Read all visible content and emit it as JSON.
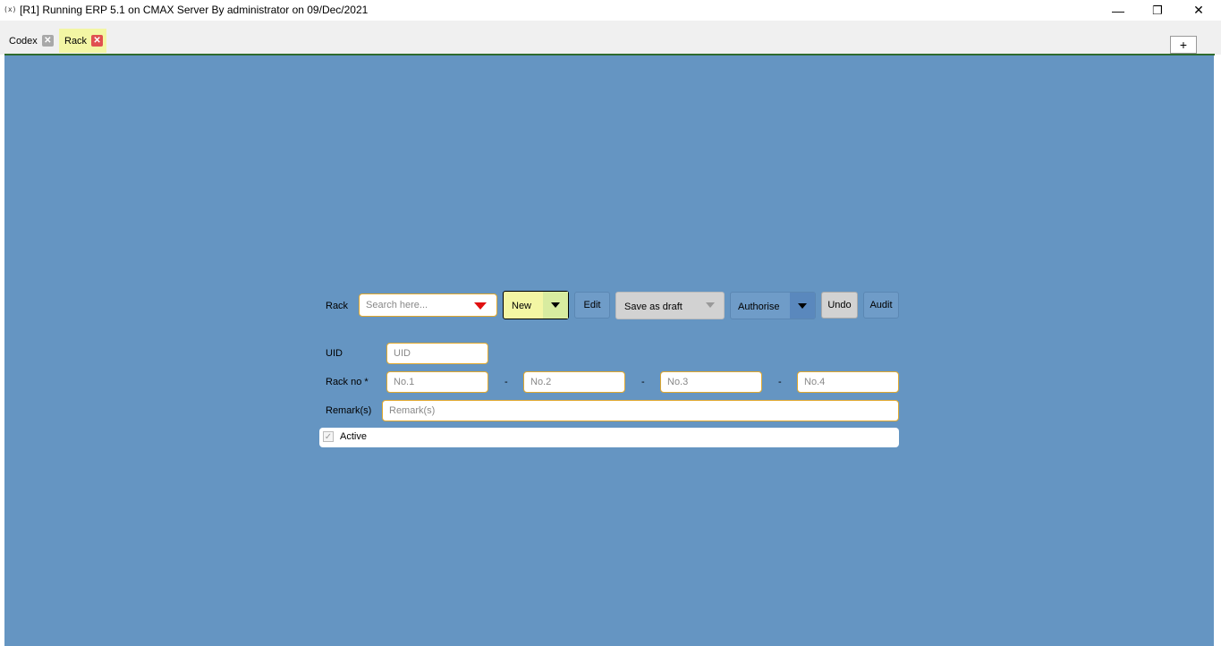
{
  "window": {
    "icon_text": "(x)",
    "title": "[R1] Running ERP 5.1 on CMAX Server By administrator on 09/Dec/2021",
    "minimize": "—",
    "restore": "❐",
    "close": "✕"
  },
  "tabs": [
    {
      "label": "Codex",
      "close": "✕",
      "active": false
    },
    {
      "label": "Rack",
      "close": "✕",
      "active": true
    }
  ],
  "add_tab_label": "+",
  "toolbar": {
    "rack_label": "Rack",
    "search_placeholder": "Search here...",
    "new_label": "New",
    "edit_label": "Edit",
    "save_draft_label": "Save as draft",
    "authorise_label": "Authorise",
    "undo_label": "Undo",
    "audit_label": "Audit"
  },
  "form": {
    "uid_label": "UID",
    "uid_placeholder": "UID",
    "rackno_label": "Rack no  *",
    "no1_placeholder": "No.1",
    "no2_placeholder": "No.2",
    "no3_placeholder": "No.3",
    "no4_placeholder": "No.4",
    "separator": "-",
    "remarks_label": "Remark(s)",
    "remarks_placeholder": "Remark(s)",
    "active_label": "Active",
    "active_checked": true
  },
  "colors": {
    "canvas": "#6595c2",
    "field_border": "#e0a82e",
    "new_button": "#f3f6a4",
    "active_tab": "#f3f6a4",
    "tab_close_active": "#e05050",
    "tab_close_inactive": "#a8a8a8"
  }
}
